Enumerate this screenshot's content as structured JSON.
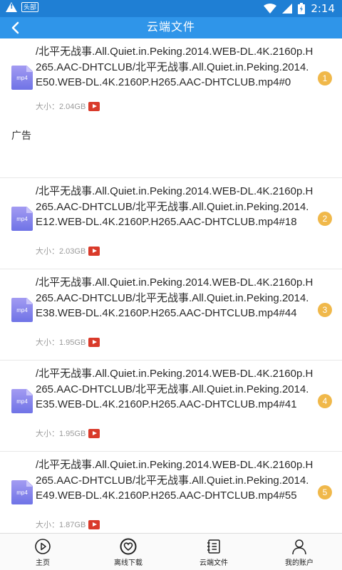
{
  "status_bar": {
    "notification_badge": "头部",
    "time": "2:14"
  },
  "app_bar": {
    "title": "云端文件"
  },
  "files": [
    {
      "name": "/北平无战事.All.Quiet.in.Peking.2014.WEB-DL.4K.2160p.H265.AAC-DHTCLUB/北平无战事.All.Quiet.in.Peking.2014.E50.WEB-DL.4K.2160P.H265.AAC-DHTCLUB.mp4#0",
      "ext": "mp4",
      "size": "大小：2.04GB",
      "index": "1"
    },
    {
      "name": "/北平无战事.All.Quiet.in.Peking.2014.WEB-DL.4K.2160p.H265.AAC-DHTCLUB/北平无战事.All.Quiet.in.Peking.2014.E12.WEB-DL.4K.2160P.H265.AAC-DHTCLUB.mp4#18",
      "ext": "mp4",
      "size": "大小：2.03GB",
      "index": "2"
    },
    {
      "name": "/北平无战事.All.Quiet.in.Peking.2014.WEB-DL.4K.2160p.H265.AAC-DHTCLUB/北平无战事.All.Quiet.in.Peking.2014.E38.WEB-DL.4K.2160P.H265.AAC-DHTCLUB.mp4#44",
      "ext": "mp4",
      "size": "大小：1.95GB",
      "index": "3"
    },
    {
      "name": "/北平无战事.All.Quiet.in.Peking.2014.WEB-DL.4K.2160p.H265.AAC-DHTCLUB/北平无战事.All.Quiet.in.Peking.2014.E35.WEB-DL.4K.2160P.H265.AAC-DHTCLUB.mp4#41",
      "ext": "mp4",
      "size": "大小：1.95GB",
      "index": "4"
    },
    {
      "name": "/北平无战事.All.Quiet.in.Peking.2014.WEB-DL.4K.2160p.H265.AAC-DHTCLUB/北平无战事.All.Quiet.in.Peking.2014.E49.WEB-DL.4K.2160P.H265.AAC-DHTCLUB.mp4#55",
      "ext": "mp4",
      "size": "大小：1.87GB",
      "index": "5"
    }
  ],
  "ad_label": "广告",
  "bottom_nav": [
    {
      "label": "主页",
      "icon": "play-circle-icon"
    },
    {
      "label": "离线下载",
      "icon": "heart-circle-icon"
    },
    {
      "label": "云端文件",
      "icon": "cloud-file-list-icon"
    },
    {
      "label": "我的账户",
      "icon": "user-icon"
    }
  ],
  "colors": {
    "status_bar": "#1f7fd4",
    "app_bar": "#2f95e9",
    "badge": "#f0b84a",
    "play": "#d93a2a",
    "file_icon": "#7b7ce8"
  }
}
